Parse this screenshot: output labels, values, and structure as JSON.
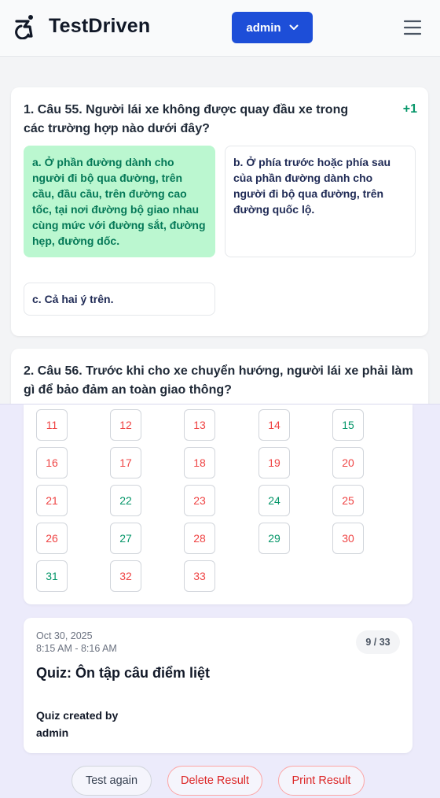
{
  "header": {
    "brand": "TestDriven",
    "user_button": "admin",
    "logo_icon": "accessibility-icon",
    "menu_icon": "hamburger-menu-icon"
  },
  "questions": [
    {
      "title": "1. Câu 55. Người lái xe không được quay đầu xe trong các trường hợp nào dưới đây?",
      "score": "+1",
      "options": [
        "a. Ở phần đường dành cho người đi bộ qua đường, trên cầu, đầu cầu, trên đường cao tốc, tại nơi đường bộ giao nhau cùng mức với đường sắt, đường hẹp, đường dốc.",
        "b. Ở phía trước hoặc phía sau của phần đường dành cho người đi bộ qua đường, trên đường quốc lộ.",
        "c. Cả hai ý trên."
      ],
      "correct_option": 0
    },
    {
      "title": "2. Câu 56. Trước khi cho xe chuyển hướng, người lái xe phải làm gì để bảo đảm an toàn giao thông?"
    }
  ],
  "question_numbers": [
    {
      "n": "11",
      "status": "wrong"
    },
    {
      "n": "12",
      "status": "wrong"
    },
    {
      "n": "13",
      "status": "wrong"
    },
    {
      "n": "14",
      "status": "wrong"
    },
    {
      "n": "15",
      "status": "right"
    },
    {
      "n": "16",
      "status": "wrong"
    },
    {
      "n": "17",
      "status": "wrong"
    },
    {
      "n": "18",
      "status": "wrong"
    },
    {
      "n": "19",
      "status": "wrong"
    },
    {
      "n": "20",
      "status": "wrong"
    },
    {
      "n": "21",
      "status": "wrong"
    },
    {
      "n": "22",
      "status": "right"
    },
    {
      "n": "23",
      "status": "wrong"
    },
    {
      "n": "24",
      "status": "right"
    },
    {
      "n": "25",
      "status": "wrong"
    },
    {
      "n": "26",
      "status": "wrong"
    },
    {
      "n": "27",
      "status": "right"
    },
    {
      "n": "28",
      "status": "wrong"
    },
    {
      "n": "29",
      "status": "right"
    },
    {
      "n": "30",
      "status": "wrong"
    },
    {
      "n": "31",
      "status": "right"
    },
    {
      "n": "32",
      "status": "wrong"
    },
    {
      "n": "33",
      "status": "wrong"
    }
  ],
  "result": {
    "date": "Oct 30, 2025",
    "time": "8:15 AM - 8:16 AM",
    "score": "9 / 33",
    "quiz_title": "Quiz: Ôn tập câu điểm liệt",
    "created_by_label": "Quiz created by",
    "created_by": "admin"
  },
  "actions": {
    "test_again": "Test again",
    "delete_result": "Delete Result",
    "print_result": "Print Result"
  },
  "colors": {
    "primary": "#1d4ed8",
    "correct": "#059669",
    "wrong": "#ef4444",
    "correct_bg": "#bbf7d0"
  }
}
